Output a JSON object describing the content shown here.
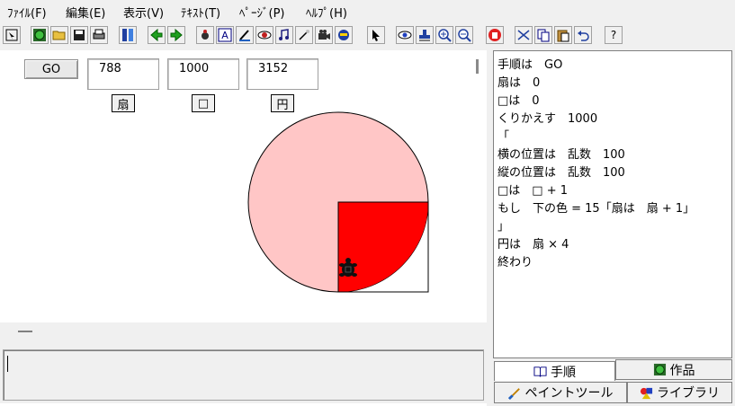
{
  "menu": {
    "items": [
      {
        "label": "ﾌｧｲﾙ(F)"
      },
      {
        "label": "編集(E)"
      },
      {
        "label": "表示(V)"
      },
      {
        "label": "ﾃｷｽﾄ(T)"
      },
      {
        "label": "ﾍﾟｰｼﾞ(P)"
      },
      {
        "label": "ﾍﾙﾌﾟ(H)"
      }
    ]
  },
  "toolbar": {
    "help_label": "?"
  },
  "stage": {
    "go_label": "GO",
    "field1_value": "788",
    "field2_value": "1000",
    "field3_value": "3152",
    "btn_fan_label": "扇",
    "btn_square_label": "□",
    "btn_circle_label": "円",
    "colors": {
      "circle_fill": "#ffc6c6",
      "square_fill": "#ff0000",
      "outline": "#000000"
    }
  },
  "code": {
    "lines": [
      "手順は　GO",
      "扇は　0",
      "□は　0",
      "くりかえす　1000",
      "「",
      "横の位置は　乱数　100",
      "縦の位置は　乱数　100",
      "□は　□ + 1",
      "もし　下の色 = 15「扇は　扇 + 1」",
      "」",
      "円は　扇 × 4",
      "終わり"
    ]
  },
  "tabs": {
    "procedure": "手順",
    "work": "作品",
    "paint_tool": "ペイントツール",
    "library": "ライブラリ"
  }
}
